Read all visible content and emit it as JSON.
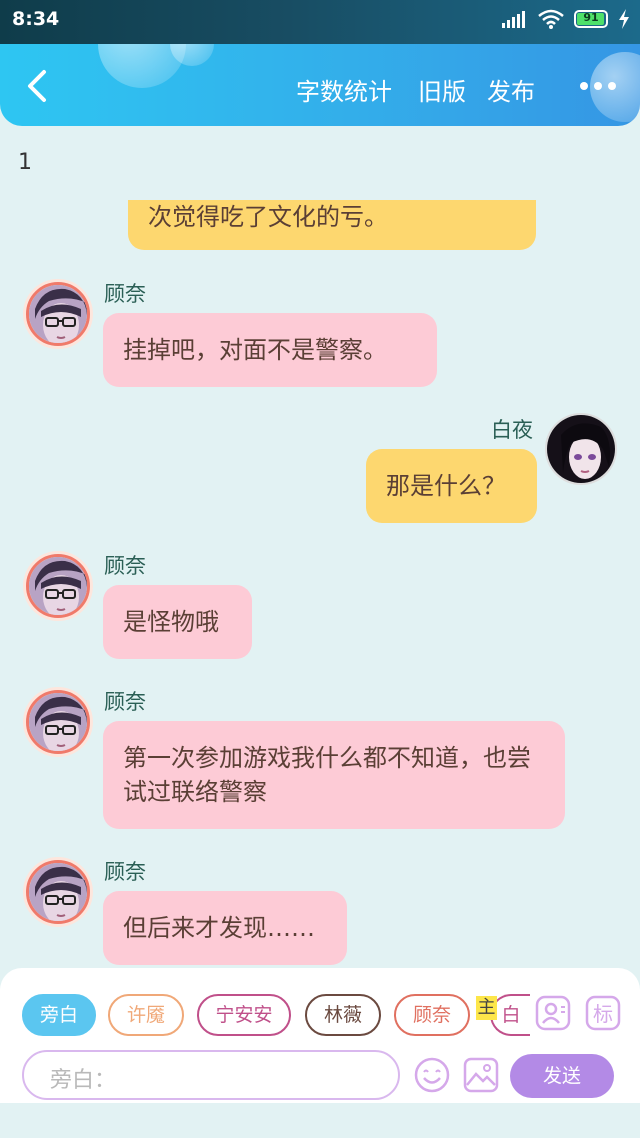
{
  "status": {
    "time": "8:34",
    "battery": "91",
    "battery_level": 0.91
  },
  "header": {
    "word_count": "字数统计",
    "old_version": "旧版",
    "publish": "发布"
  },
  "page_number": "1",
  "messages": [
    {
      "sender": "",
      "text": "次觉得吃了文化的亏。",
      "side": "right"
    },
    {
      "sender": "顾奈",
      "text": "挂掉吧，对面不是警察。",
      "side": "left"
    },
    {
      "sender": "白夜",
      "text": "那是什么？",
      "side": "right"
    },
    {
      "sender": "顾奈",
      "text": "是怪物哦",
      "side": "left"
    },
    {
      "sender": "顾奈",
      "text": "第一次参加游戏我什么都不知道，也尝试过联络警察",
      "side": "left"
    },
    {
      "sender": "顾奈",
      "text": "但后来才发现……",
      "side": "left"
    }
  ],
  "characters": [
    {
      "label": "旁白",
      "color": "#5bc6f0",
      "selected": true
    },
    {
      "label": "许魇",
      "color": "#f0a878"
    },
    {
      "label": "宁安安",
      "color": "#c0508a"
    },
    {
      "label": "林薇",
      "color": "#6b4a40"
    },
    {
      "label": "顾奈",
      "color": "#e07060"
    },
    {
      "label": "白",
      "color": "#c0508a"
    }
  ],
  "role_badge": "主",
  "input": {
    "label": "旁白：",
    "placeholder": ""
  },
  "send_label": "发送",
  "colors": {
    "header_start": "#2ec6f2",
    "header_end": "#3596e4",
    "pink_bubble": "#fdcbd6",
    "yellow_bubble": "#fdd76f",
    "send": "#b38ae6"
  },
  "icons": [
    "back-icon",
    "more-icon",
    "signal-icon",
    "wifi-icon",
    "battery-icon",
    "charging-icon",
    "contact-icon",
    "tag-icon",
    "emoji-icon",
    "image-icon"
  ]
}
